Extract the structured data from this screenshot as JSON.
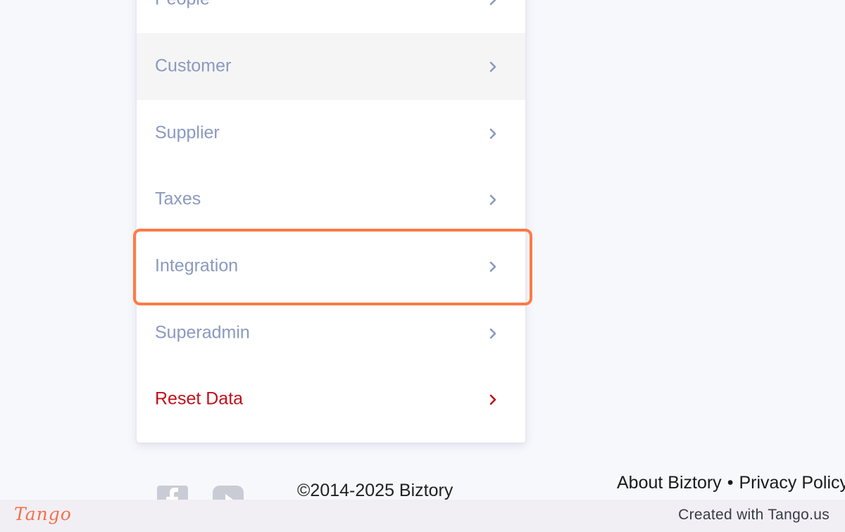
{
  "menu": {
    "items": [
      {
        "label": "People"
      },
      {
        "label": "Customer"
      },
      {
        "label": "Supplier"
      },
      {
        "label": "Taxes"
      },
      {
        "label": "Integration"
      },
      {
        "label": "Superadmin"
      },
      {
        "label": "Reset Data"
      }
    ],
    "highlighted_item": "Integration",
    "colors": {
      "label": "#8b99c0",
      "danger": "#c0101a",
      "active_row": "#f5f5f5",
      "highlight_border": "#ff7a45"
    }
  },
  "footer": {
    "social_icons": [
      "facebook-icon",
      "youtube-icon"
    ],
    "copyright": "©2014-2025 Biztory",
    "links": {
      "about": "About Biztory",
      "separator": "•",
      "privacy": "Privacy Policy"
    }
  },
  "tango": {
    "logo": "Tango",
    "credit": "Created with Tango.us"
  }
}
